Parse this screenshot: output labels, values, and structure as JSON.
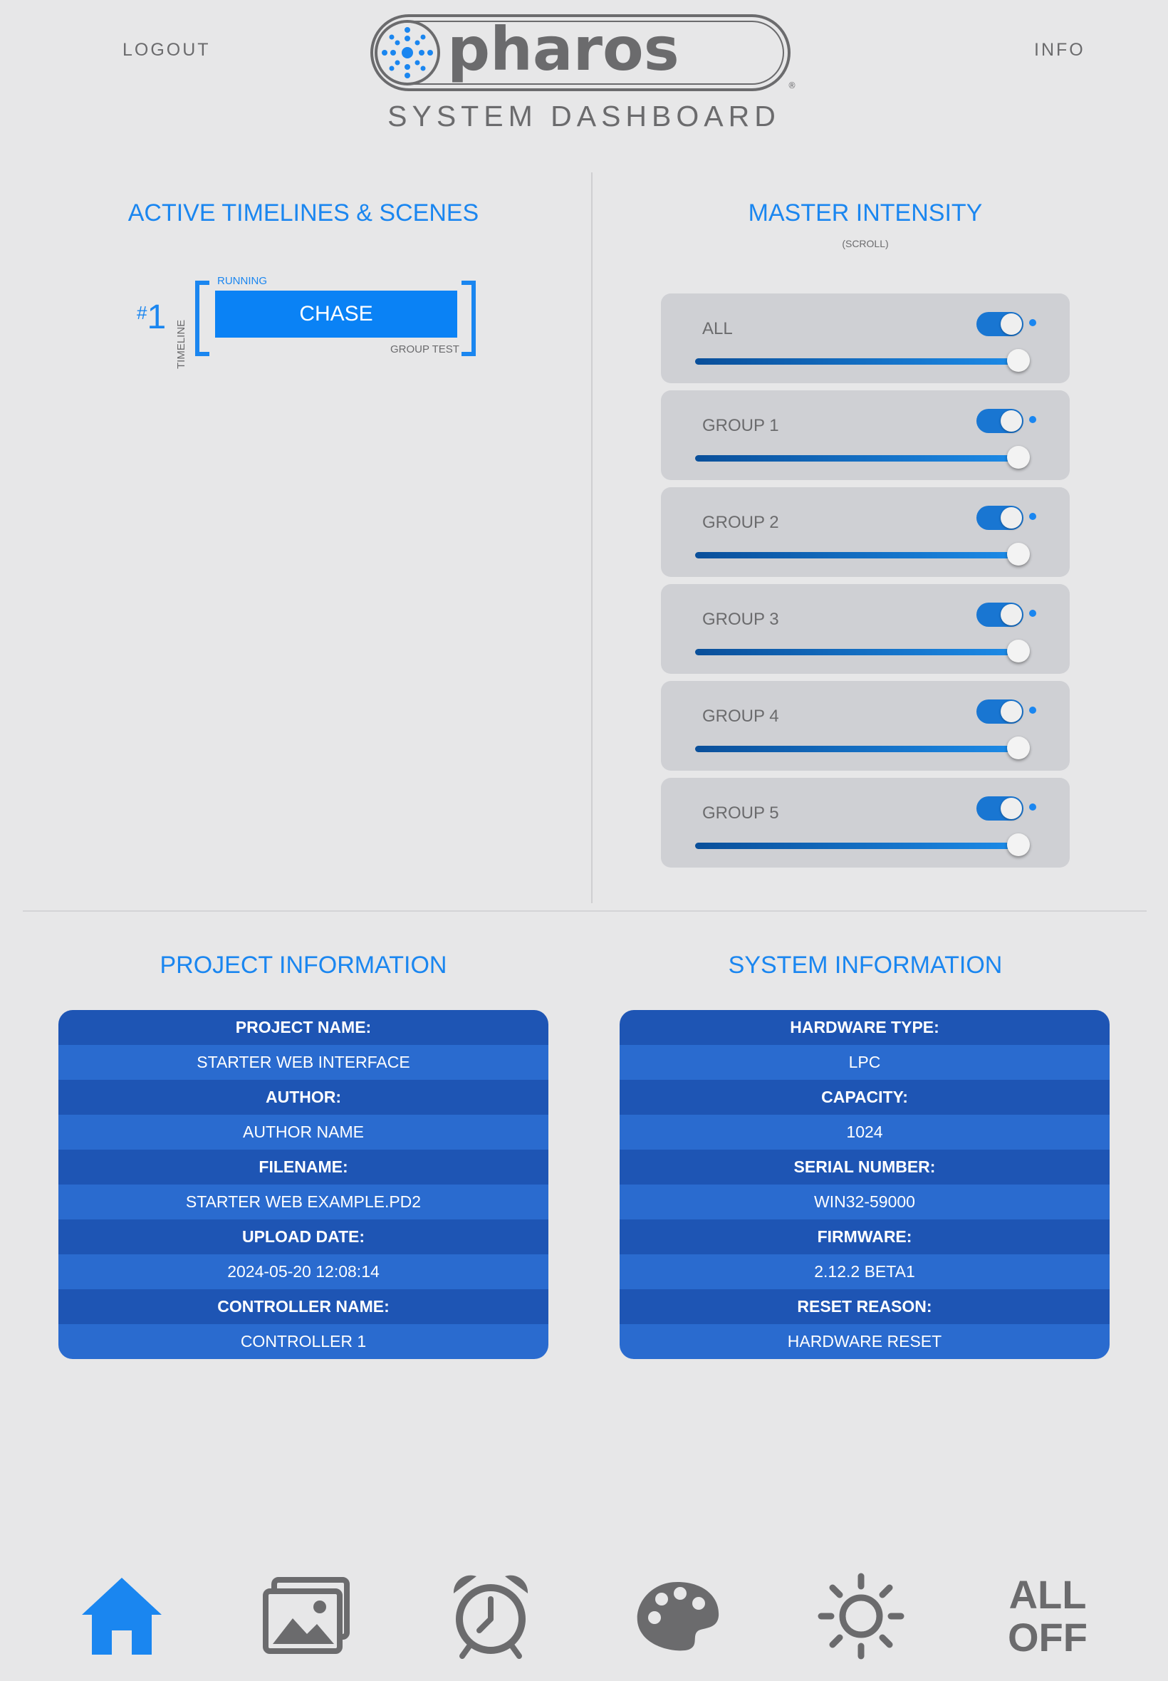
{
  "header": {
    "logout_label": "LOGOUT",
    "info_label": "INFO",
    "logo_text": "pharos",
    "subtitle": "SYSTEM DASHBOARD"
  },
  "active": {
    "title": "ACTIVE TIMELINES & SCENES",
    "timeline": {
      "number_prefix": "#",
      "number": "1",
      "vertical_label": "TIMELINE",
      "state": "RUNNING",
      "name": "CHASE",
      "group": "GROUP TEST"
    }
  },
  "master": {
    "title": "MASTER INTENSITY",
    "hint": "(SCROLL)",
    "groups": [
      {
        "label": "ALL",
        "on": true,
        "level": 1.0
      },
      {
        "label": "GROUP 1",
        "on": true,
        "level": 1.0
      },
      {
        "label": "GROUP 2",
        "on": true,
        "level": 1.0
      },
      {
        "label": "GROUP 3",
        "on": true,
        "level": 1.0
      },
      {
        "label": "GROUP 4",
        "on": true,
        "level": 1.0
      },
      {
        "label": "GROUP 5",
        "on": true,
        "level": 1.0
      }
    ]
  },
  "project": {
    "title": "PROJECT INFORMATION",
    "rows": [
      {
        "key": "PROJECT NAME:",
        "value": "STARTER WEB INTERFACE"
      },
      {
        "key": "AUTHOR:",
        "value": "AUTHOR NAME"
      },
      {
        "key": "FILENAME:",
        "value": "STARTER WEB EXAMPLE.PD2"
      },
      {
        "key": "UPLOAD DATE:",
        "value": "2024-05-20 12:08:14"
      },
      {
        "key": "CONTROLLER NAME:",
        "value": "CONTROLLER 1"
      }
    ]
  },
  "system": {
    "title": "SYSTEM INFORMATION",
    "rows": [
      {
        "key": "HARDWARE TYPE:",
        "value": "LPC"
      },
      {
        "key": "CAPACITY:",
        "value": "1024"
      },
      {
        "key": "SERIAL NUMBER:",
        "value": "WIN32-59000"
      },
      {
        "key": "FIRMWARE:",
        "value": "2.12.2 BETA1"
      },
      {
        "key": "RESET REASON:",
        "value": "HARDWARE RESET"
      }
    ]
  },
  "nav": {
    "icons": [
      "home-icon",
      "images-icon",
      "alarm-clock-icon",
      "palette-icon",
      "sun-icon"
    ],
    "all_off_line1": "ALL",
    "all_off_line2": "OFF"
  },
  "colors": {
    "accent": "#1a86f0",
    "active_nav": "#1a86f0",
    "nav_gray": "#6b6b6d",
    "table_key": "#1e55b4",
    "table_value": "#2a6bcf",
    "card_bg": "#cfd0d4",
    "page_bg": "#e7e7e8"
  }
}
